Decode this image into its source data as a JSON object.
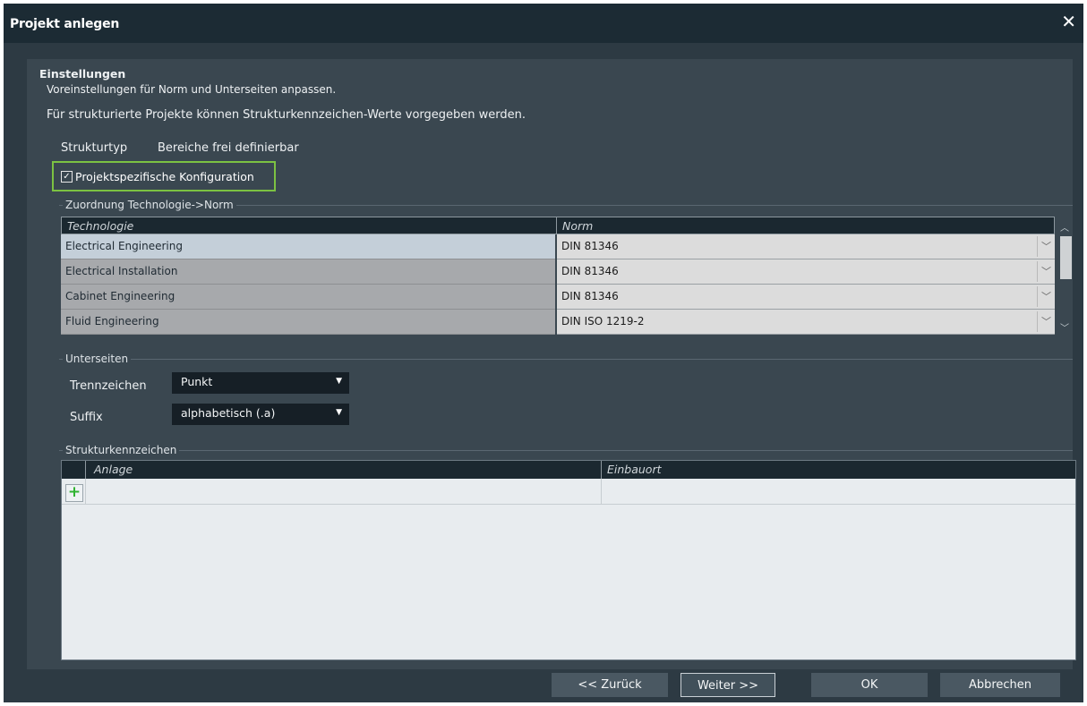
{
  "window": {
    "title": "Projekt anlegen",
    "close_glyph": "✕"
  },
  "intro": {
    "heading": "Einstellungen",
    "subheading": "Voreinstellungen für Norm und Unterseiten anpassen.",
    "hint": "Für strukturierte Projekte können Strukturkennzeichen-Werte vorgegeben werden."
  },
  "struktur": {
    "label": "Strukturtyp",
    "value": "Bereiche frei definierbar"
  },
  "config_checkbox": {
    "label": "Projektspezifische Konfiguration",
    "checked": true
  },
  "zuordnung": {
    "group_label": "Zuordnung Technologie->Norm",
    "columns": [
      "Technologie",
      "Norm"
    ],
    "rows": [
      {
        "technologie": "Electrical Engineering",
        "norm": "DIN 81346",
        "selected": true
      },
      {
        "technologie": "Electrical Installation",
        "norm": "DIN 81346",
        "selected": false
      },
      {
        "technologie": "Cabinet Engineering",
        "norm": "DIN 81346",
        "selected": false
      },
      {
        "technologie": "Fluid Engineering",
        "norm": "DIN ISO 1219-2",
        "selected": false
      }
    ]
  },
  "unterseiten": {
    "group_label": "Unterseiten",
    "trennzeichen": {
      "label": "Trennzeichen",
      "value": "Punkt"
    },
    "suffix": {
      "label": "Suffix",
      "value": "alphabetisch (.a)"
    }
  },
  "strukturkennzeichen": {
    "group_label": "Strukturkennzeichen",
    "columns": [
      "Anlage",
      "Einbauort"
    ],
    "add_glyph": "+"
  },
  "buttons": {
    "back": "<< Zurück",
    "next": "Weiter >>",
    "ok": "OK",
    "cancel": "Abbrechen"
  },
  "colors": {
    "highlight": "#7cc242",
    "selected_row": "#c4cfd9",
    "normal_row": "#a7a9ac",
    "add_icon": "#2fb330"
  }
}
